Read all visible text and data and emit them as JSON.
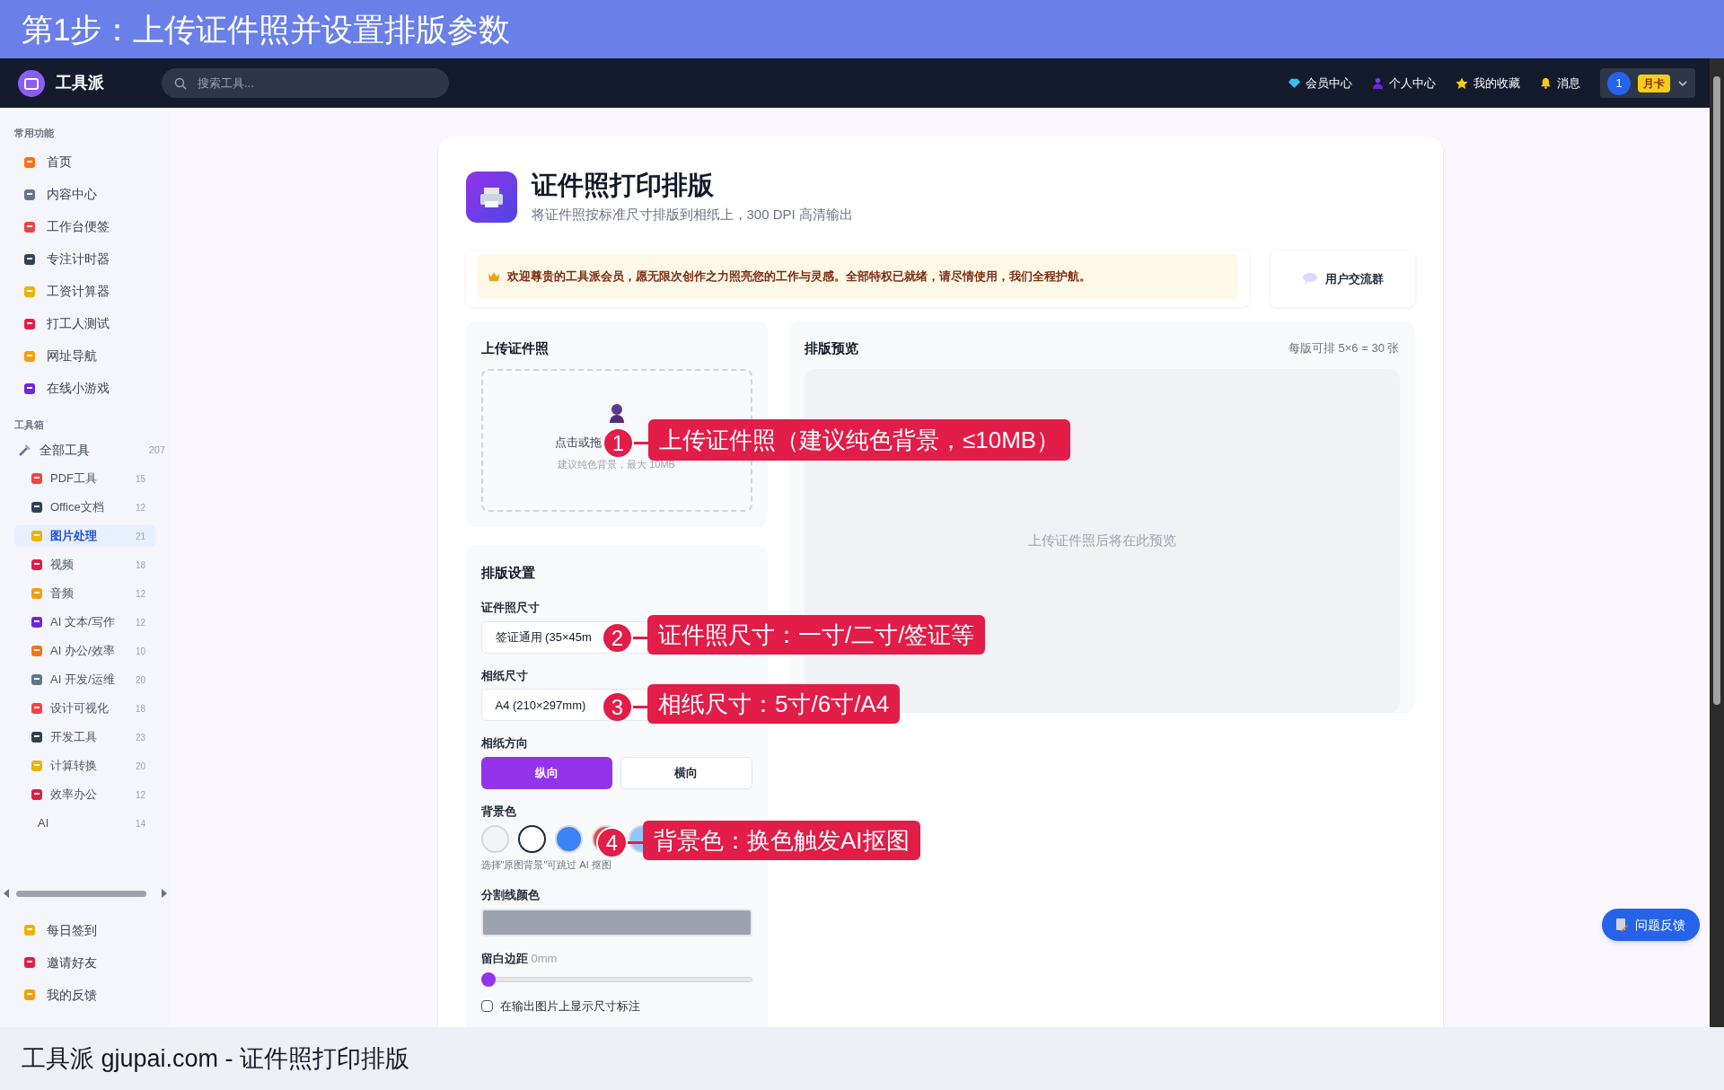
{
  "banner": {
    "title": "第1步：上传证件照并设置排版参数"
  },
  "navbar": {
    "brand": "工具派",
    "search": {
      "placeholder": "搜索工具..."
    },
    "links": [
      "会员中心",
      "个人中心",
      "我的收藏",
      "消息"
    ],
    "user": {
      "badge": "1",
      "plan": "月卡"
    }
  },
  "sidebar": {
    "common": {
      "title": "常用功能",
      "items": [
        "首页",
        "内容中心",
        "工作台便签",
        "专注计时器",
        "工资计算器",
        "打工人测试",
        "网址导航",
        "在线小游戏"
      ]
    },
    "toolbox": {
      "title": "工具箱",
      "all": {
        "label": "全部工具",
        "count": "207"
      },
      "children": [
        {
          "label": "PDF工具",
          "count": "15",
          "selected": false
        },
        {
          "label": "Office文档",
          "count": "12",
          "selected": false
        },
        {
          "label": "图片处理",
          "count": "21",
          "selected": true
        },
        {
          "label": "视频",
          "count": "18",
          "selected": false
        },
        {
          "label": "音频",
          "count": "12",
          "selected": false
        },
        {
          "label": "AI 文本/写作",
          "count": "12",
          "selected": false
        },
        {
          "label": "AI 办公/效率",
          "count": "10",
          "selected": false
        },
        {
          "label": "AI 开发/运维",
          "count": "20",
          "selected": false
        },
        {
          "label": "设计可视化",
          "count": "18",
          "selected": false
        },
        {
          "label": "开发工具",
          "count": "23",
          "selected": false
        },
        {
          "label": "计算转换",
          "count": "20",
          "selected": false
        },
        {
          "label": "效率办公",
          "count": "12",
          "selected": false
        },
        {
          "label": "AI",
          "count": "14",
          "selected": false
        }
      ]
    },
    "footer_items": [
      "每日签到",
      "邀请好友",
      "我的反馈"
    ]
  },
  "tool": {
    "title": "证件照打印排版",
    "subtitle": "将证件照按标准尺寸排版到相纸上，300 DPI 高清输出"
  },
  "notice": {
    "text": "欢迎尊贵的工具派会员，愿无限次创作之力照亮您的工作与灵感。全部特权已就绪，请尽情使用，我们全程护航。"
  },
  "community_button": "用户交流群",
  "upload": {
    "title": "上传证件照",
    "prompt": "点击或拖",
    "hint": "建议纯色背景，最大 10MB"
  },
  "settings": {
    "title": "排版设置",
    "photo_size": {
      "label": "证件照尺寸",
      "value": "签证通用 (35×45m"
    },
    "paper_size": {
      "label": "相纸尺寸",
      "value": "A4 (210×297mm)"
    },
    "orientation": {
      "label": "相纸方向",
      "options": [
        {
          "label": "纵向",
          "selected": true
        },
        {
          "label": "横向",
          "selected": false
        }
      ]
    },
    "background": {
      "label": "背景色",
      "swatches": [
        {
          "color": "#f3f4f6",
          "selected": false
        },
        {
          "color": "#ffffff",
          "selected": true
        },
        {
          "color": "#3b82f6",
          "selected": false
        },
        {
          "color": "#ef4444",
          "selected": false
        },
        {
          "color": "#93c5fd",
          "selected": false
        }
      ],
      "hint": "选择\"原图背景\"可跳过 AI 抠图"
    },
    "divider_color": {
      "label": "分割线颜色",
      "color": "#9ca3af"
    },
    "margin": {
      "label": "留白边距",
      "value": "0mm",
      "level": 0
    },
    "show_size_labels": {
      "label": "在输出图片上显示尺寸标注",
      "checked": false
    }
  },
  "preview": {
    "title": "排版预览",
    "capacity": "每版可排 5×6 = 30 张",
    "placeholder": "上传证件照后将在此预览"
  },
  "feedback_button": "问题反馈",
  "annotations": [
    {
      "number": "1",
      "text": "上传证件照（建议纯色背景，≤10MB）"
    },
    {
      "number": "2",
      "text": "证件照尺寸：一寸/二寸/签证等"
    },
    {
      "number": "3",
      "text": "相纸尺寸：5寸/6寸/A4"
    },
    {
      "number": "4",
      "text": "背景色：换色触发AI抠图"
    }
  ],
  "caption": "工具派 gjupai.com - 证件照打印排版"
}
